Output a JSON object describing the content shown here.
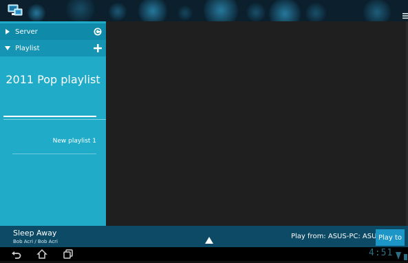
{
  "header": {
    "app_icon": "media-server-icon",
    "menu_icon": "overflow-menu-icon"
  },
  "sidebar": {
    "server_label": "Server",
    "server_action_icon": "refresh-icon",
    "playlist_label": "Playlist",
    "playlist_action_icon": "add-icon",
    "featured_playlist": "2011 Pop playlist",
    "items": [
      {
        "label": "New playlist 1"
      }
    ]
  },
  "now_playing": {
    "title": "Sleep Away",
    "artist": "Bob Acri / Bob Acri",
    "play_from": "Play from: ASUS-PC: ASUS:",
    "play_to_label": "Play to"
  },
  "system_bar": {
    "clock": "4:51"
  },
  "colors": {
    "sidebar": "#20acc9",
    "section_row": "#0f8aa8",
    "content": "#1f1f1f",
    "now_playing_bar": "#0d4a66",
    "play_to_button": "#1c96c7"
  }
}
